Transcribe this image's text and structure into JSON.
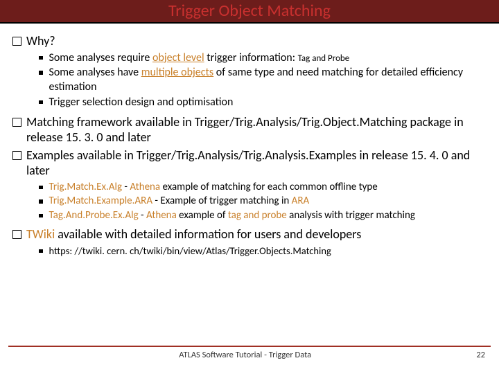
{
  "title": "Trigger Object Matching",
  "sections": [
    {
      "label": "Why?",
      "subs": [
        {
          "html": "Some analyses require <span class='func u'>object level</span> trigger information: <span class='small'>Tag and Probe</span>"
        },
        {
          "html": "Some analyses have <span class='func u'>multiple objects</span> of same type and need matching for detailed efficiency estimation"
        },
        {
          "html": "Trigger selection design and optimisation"
        }
      ]
    },
    {
      "html": "Matching framework available in Trigger/Trig.Analysis/Trig.Object.Matching package in release 15. 3. 0 and later"
    },
    {
      "html": "Examples available in Trigger/Trig.Analysis/Trig.Analysis.Examples in release 15. 4. 0 and later",
      "subs": [
        {
          "html": "<span class='func'>Trig.Match.Ex.Alg</span> - <span class='func'>Athena</span> example of matching for each common offline type"
        },
        {
          "html": "<span class='func'>Trig.Match.Example.ARA</span> - Example of trigger matching in <span class='func'>ARA</span>"
        },
        {
          "html": "<span class='func'>Tag.And.Probe.Ex.Alg</span> - <span class='func'>Athena</span> example of <span class='func'>tag and probe</span> analysis with trigger matching"
        }
      ]
    },
    {
      "html": "<span class='func'>TWiki</span> available with detailed information for users and developers",
      "subs": [
        {
          "html": "https: //twiki. cern. ch/twiki/bin/view/Atlas/Trigger.Objects.Matching"
        }
      ]
    }
  ],
  "footer": {
    "center": "ATLAS Software Tutorial - Trigger Data",
    "page": "22"
  }
}
